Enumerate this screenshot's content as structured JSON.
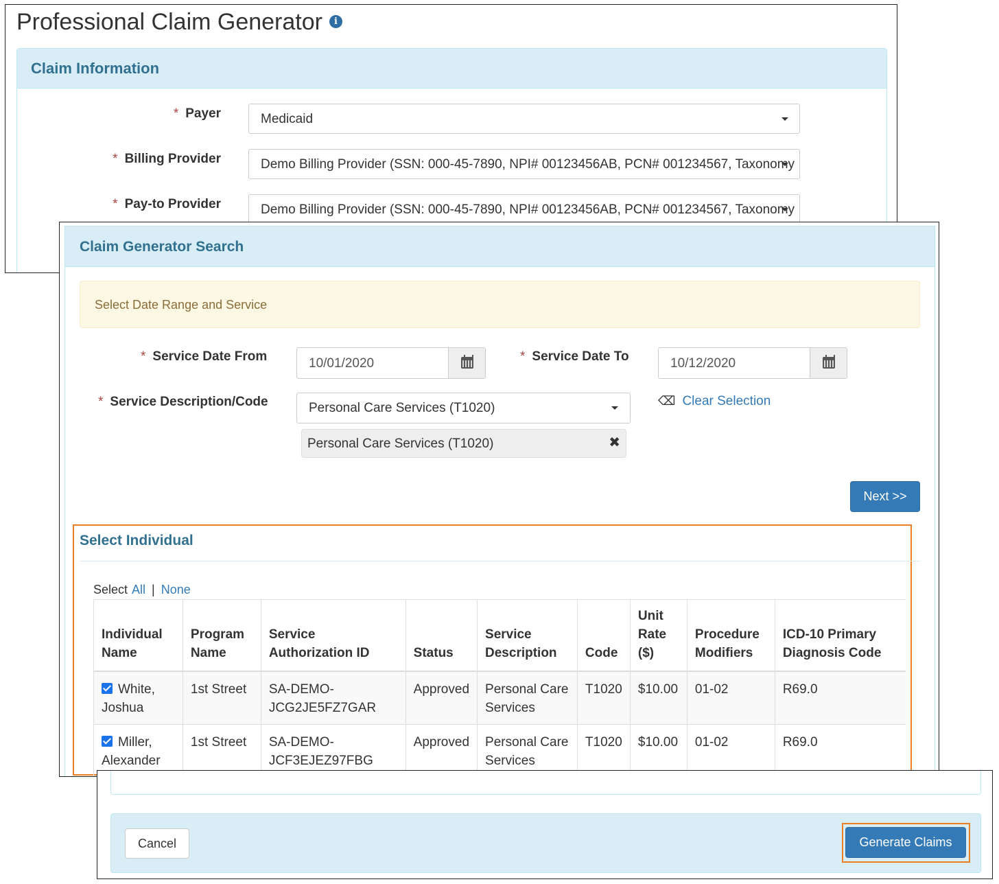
{
  "header": {
    "title": "Professional Claim Generator",
    "info_icon": "info-icon"
  },
  "claim_info": {
    "heading": "Claim Information",
    "payer": {
      "label": "Payer",
      "value": "Medicaid"
    },
    "billing_provider": {
      "label": "Billing Provider",
      "value": "Demo Billing Provider (SSN: 000-45-7890, NPI# 00123456AB, PCN# 001234567, Taxonomy"
    },
    "pay_to_provider": {
      "label": "Pay-to Provider",
      "value": "Demo Billing Provider (SSN: 000-45-7890, NPI# 00123456AB, PCN# 001234567, Taxonomy"
    }
  },
  "search": {
    "heading": "Claim Generator Search",
    "alert": "Select Date Range and Service",
    "date_from": {
      "label": "Service Date From",
      "value": "10/01/2020"
    },
    "date_to": {
      "label": "Service Date To",
      "value": "10/12/2020"
    },
    "service": {
      "label": "Service Description/Code",
      "value": "Personal Care Services (T1020)",
      "selected_chip": "Personal Care Services (T1020)"
    },
    "clear_selection": "Clear Selection",
    "next_button": "Next >>"
  },
  "individuals": {
    "heading": "Select Individual",
    "select_label": "Select",
    "all_link": "All",
    "separator": "|",
    "none_link": "None",
    "columns": {
      "name_1": "Individual",
      "name_2": "Name",
      "program_1": "Program",
      "program_2": "Name",
      "auth_1": "Service",
      "auth_2": "Authorization ID",
      "status": "Status",
      "desc_1": "Service",
      "desc_2": "Description",
      "code": "Code",
      "rate_1": "Unit",
      "rate_2": "Rate",
      "rate_3": "($)",
      "mod_1": "Procedure",
      "mod_2": "Modifiers",
      "icd_1": "ICD-10 Primary",
      "icd_2": "Diagnosis Code"
    },
    "rows": [
      {
        "checked": true,
        "name_1": "White,",
        "name_2": "Joshua",
        "program": "1st Street",
        "auth_1": "SA-DEMO-",
        "auth_2": "JCG2JE5FZ7GAR",
        "status": "Approved",
        "desc_1": "Personal Care",
        "desc_2": "Services",
        "code": "T1020",
        "rate": "$10.00",
        "modifiers": "01-02",
        "icd": "R69.0"
      },
      {
        "checked": true,
        "name_1": "Miller,",
        "name_2": "Alexander",
        "program": "1st Street",
        "auth_1": "SA-DEMO-",
        "auth_2": "JCF3EJEZ97FBG",
        "status": "Approved",
        "desc_1": "Personal Care",
        "desc_2": "Services",
        "code": "T1020",
        "rate": "$10.00",
        "modifiers": "01-02",
        "icd": "R69.0"
      }
    ]
  },
  "footer": {
    "cancel_button": "Cancel",
    "generate_button": "Generate Claims"
  },
  "colors": {
    "accent": "#337ab7",
    "panel_heading": "#31708f",
    "highlight": "#e87f24",
    "required": "#a94442"
  }
}
